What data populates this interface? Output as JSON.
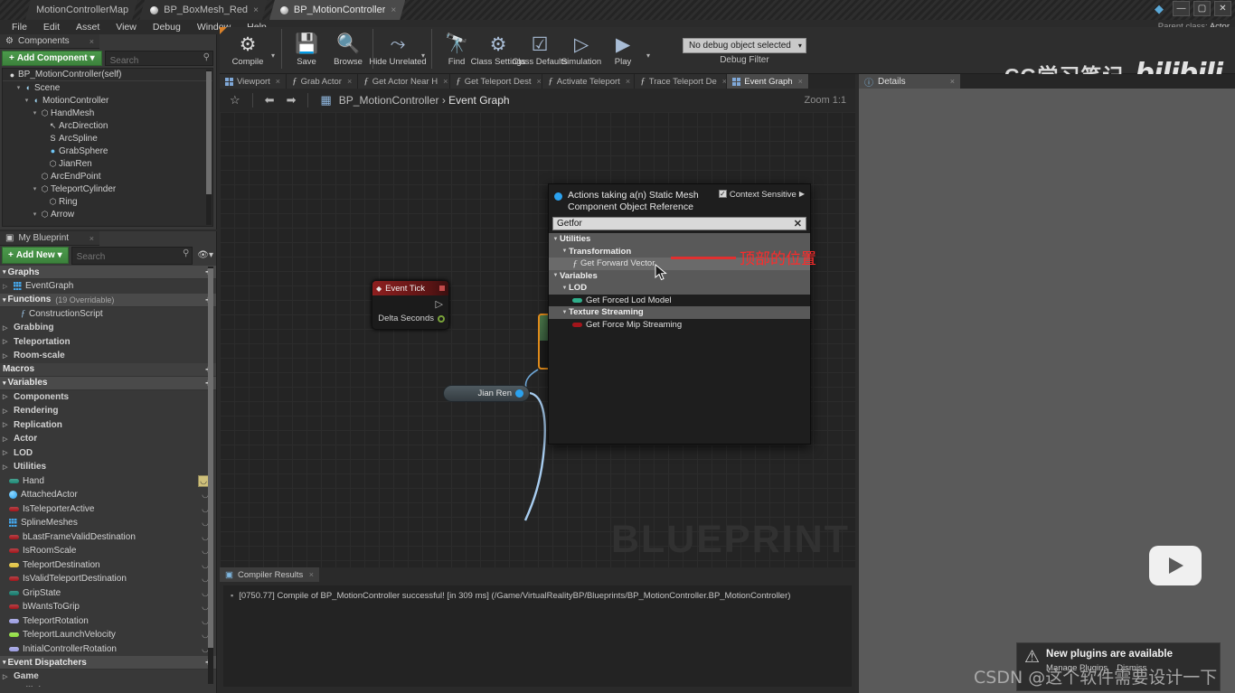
{
  "window": {
    "logo_icon": "unreal-engine-logo",
    "tabs": [
      {
        "label": "MotionControllerMap",
        "active": false,
        "has_dot": false,
        "closable": false
      },
      {
        "label": "BP_BoxMesh_Red",
        "active": false,
        "has_dot": true,
        "closable": true
      },
      {
        "label": "BP_MotionController",
        "active": true,
        "has_dot": true,
        "closable": true
      }
    ],
    "controls": {
      "gem_icon": "unreal-gem-icon",
      "minimize": "—",
      "maximize": "▢",
      "close": "✕"
    }
  },
  "menubar": {
    "items": [
      "File",
      "Edit",
      "Asset",
      "View",
      "Debug",
      "Window",
      "Help"
    ],
    "parent_class_label": "Parent class:",
    "parent_class_value": "Actor"
  },
  "components_panel": {
    "tab_label": "Components",
    "tab_close": "×",
    "add_component_label": "Add Component",
    "add_component_caret": "▾",
    "search_placeholder": "Search",
    "search_icon": "magnifier-icon",
    "root": {
      "label": "BP_MotionController(self)",
      "icon": "sphere-icon"
    },
    "tree": [
      {
        "label": "Scene",
        "depth": 1,
        "arrow": "▾",
        "icon": "scene-icon"
      },
      {
        "label": "MotionController",
        "depth": 2,
        "arrow": "▾",
        "icon": "scene-icon"
      },
      {
        "label": "HandMesh",
        "depth": 3,
        "arrow": "▾",
        "icon": "mesh-icon"
      },
      {
        "label": "ArcDirection",
        "depth": 4,
        "arrow": "",
        "icon": "arrow-icon"
      },
      {
        "label": "ArcSpline",
        "depth": 4,
        "arrow": "",
        "icon": "spline-icon"
      },
      {
        "label": "GrabSphere",
        "depth": 4,
        "arrow": "",
        "icon": "sphere-icon"
      },
      {
        "label": "JianRen",
        "depth": 4,
        "arrow": "",
        "icon": "mesh-icon"
      },
      {
        "label": "ArcEndPoint",
        "depth": 3,
        "arrow": "",
        "icon": "mesh-icon"
      },
      {
        "label": "TeleportCylinder",
        "depth": 3,
        "arrow": "▾",
        "icon": "mesh-icon"
      },
      {
        "label": "Ring",
        "depth": 4,
        "arrow": "",
        "icon": "mesh-icon"
      },
      {
        "label": "Arrow",
        "depth": 3,
        "arrow": "▾",
        "icon": "mesh-icon"
      }
    ]
  },
  "myblueprint_panel": {
    "tab_label": "My Blueprint",
    "tab_close": "×",
    "add_new_label": "Add New",
    "add_new_caret": "▾",
    "search_placeholder": "Search",
    "eye_icon": "eye-icon",
    "sections": [
      {
        "type": "section",
        "label": "Graphs",
        "arrow": "▾",
        "plus": "+"
      },
      {
        "type": "item",
        "label": "EventGraph",
        "arrow": "▷",
        "icon": "graph-icon",
        "bold": false,
        "indent": 0
      },
      {
        "type": "section",
        "label": "Functions",
        "count": "(19 Overridable)",
        "arrow": "▾",
        "plus": "+"
      },
      {
        "type": "item",
        "label": "ConstructionScript",
        "arrow": "",
        "icon": "function-icon",
        "bold": false,
        "indent": 1
      },
      {
        "type": "item",
        "label": "Grabbing",
        "arrow": "▷",
        "icon": "",
        "bold": true,
        "indent": 0
      },
      {
        "type": "item",
        "label": "Teleportation",
        "arrow": "▷",
        "icon": "",
        "bold": true,
        "indent": 0
      },
      {
        "type": "item",
        "label": "Room-scale",
        "arrow": "▷",
        "icon": "",
        "bold": true,
        "indent": 0
      },
      {
        "type": "section-plain",
        "label": "Macros",
        "arrow": "",
        "plus": "+"
      },
      {
        "type": "section",
        "label": "Variables",
        "arrow": "▾",
        "plus": "+"
      },
      {
        "type": "item",
        "label": "Components",
        "arrow": "▷",
        "icon": "",
        "bold": true,
        "indent": 0
      },
      {
        "type": "item",
        "label": "Rendering",
        "arrow": "▷",
        "icon": "",
        "bold": true,
        "indent": 0
      },
      {
        "type": "item",
        "label": "Replication",
        "arrow": "▷",
        "icon": "",
        "bold": true,
        "indent": 0
      },
      {
        "type": "item",
        "label": "Actor",
        "arrow": "▷",
        "icon": "",
        "bold": true,
        "indent": 0
      },
      {
        "type": "item",
        "label": "LOD",
        "arrow": "▷",
        "icon": "",
        "bold": true,
        "indent": 0
      },
      {
        "type": "item",
        "label": "Utilities",
        "arrow": "▷",
        "icon": "",
        "bold": true,
        "indent": 0
      },
      {
        "type": "var",
        "label": "Hand",
        "icon": "pill",
        "color": "#1d8a76",
        "eye": "boxed"
      },
      {
        "type": "var",
        "label": "AttachedActor",
        "icon": "sphere",
        "color": "#2ba2ef",
        "eye": "eye"
      },
      {
        "type": "var",
        "label": "IsTeleporterActive",
        "icon": "pill",
        "color": "#a3151b",
        "eye": "eye"
      },
      {
        "type": "var",
        "label": "SplineMeshes",
        "icon": "grid",
        "color": "#45a5e8",
        "eye": "eye"
      },
      {
        "type": "var",
        "label": "bLastFrameValidDestination",
        "icon": "pill",
        "color": "#a3151b",
        "eye": "eye"
      },
      {
        "type": "var",
        "label": "IsRoomScale",
        "icon": "pill",
        "color": "#a3151b",
        "eye": "eye"
      },
      {
        "type": "var",
        "label": "TeleportDestination",
        "icon": "pill",
        "color": "#e0c03a",
        "eye": "eye"
      },
      {
        "type": "var",
        "label": "IsValidTeleportDestination",
        "icon": "pill",
        "color": "#a3151b",
        "eye": "eye"
      },
      {
        "type": "var",
        "label": "GripState",
        "icon": "pill",
        "color": "#127a6b",
        "eye": "eye"
      },
      {
        "type": "var",
        "label": "bWantsToGrip",
        "icon": "pill",
        "color": "#a3151b",
        "eye": "eye"
      },
      {
        "type": "var",
        "label": "TeleportRotation",
        "icon": "pill",
        "color": "#9b9ce0",
        "eye": "eye"
      },
      {
        "type": "var",
        "label": "TeleportLaunchVelocity",
        "icon": "pill",
        "color": "#8ddc3a",
        "eye": "eye"
      },
      {
        "type": "var",
        "label": "InitialControllerRotation",
        "icon": "pill",
        "color": "#9b9ce0",
        "eye": "eye"
      },
      {
        "type": "section",
        "label": "Event Dispatchers",
        "arrow": "▾",
        "plus": "+"
      },
      {
        "type": "item",
        "label": "Game",
        "arrow": "▷",
        "icon": "",
        "bold": true,
        "indent": 0
      },
      {
        "type": "item",
        "label": "Collision",
        "arrow": "▷",
        "icon": "",
        "bold": true,
        "indent": 0
      }
    ]
  },
  "toolbar": {
    "buttons": [
      {
        "label": "Compile",
        "icon": "compile-gear-question-icon",
        "glyph": "⚙",
        "caret": true
      },
      {
        "label": "Save",
        "icon": "save-floppy-icon",
        "glyph": "💾",
        "caret": false
      },
      {
        "label": "Browse",
        "icon": "browse-magnifier-icon",
        "glyph": "🔍",
        "caret": false
      },
      {
        "label": "Hide Unrelated",
        "icon": "hide-unrelated-nodes-icon",
        "glyph": "⤳",
        "caret": true
      },
      {
        "label": "Find",
        "icon": "find-binoculars-icon",
        "glyph": "🔭",
        "caret": false
      },
      {
        "label": "Class Settings",
        "icon": "class-settings-gear-icon",
        "glyph": "⚙",
        "caret": false
      },
      {
        "label": "Class Defaults",
        "icon": "class-defaults-list-icon",
        "glyph": "☑",
        "caret": false
      },
      {
        "label": "Simulation",
        "icon": "simulation-icon",
        "glyph": "▷",
        "caret": false
      },
      {
        "label": "Play",
        "icon": "play-icon",
        "glyph": "▶",
        "caret": true
      }
    ],
    "debug_filter_value": "No debug object selected",
    "debug_filter_caret": "▾",
    "debug_filter_label": "Debug Filter",
    "brand_cg": "CG学习笔记",
    "brand_bilibili": "bilibili"
  },
  "graph_tabs": [
    {
      "label": "Viewport",
      "icon": "viewport-grid-icon",
      "active": false
    },
    {
      "label": "Grab Actor",
      "icon": "function-icon",
      "active": false
    },
    {
      "label": "Get Actor Near H",
      "icon": "function-icon",
      "active": false
    },
    {
      "label": "Get Teleport Dest",
      "icon": "function-icon",
      "active": false
    },
    {
      "label": "Activate Teleport",
      "icon": "function-icon",
      "active": false
    },
    {
      "label": "Trace Teleport De",
      "icon": "function-icon",
      "active": false
    },
    {
      "label": "Event Graph",
      "icon": "graph-icon",
      "active": true
    }
  ],
  "details_panel": {
    "tab_label": "Details",
    "tab_icon": "info-magnifier-icon",
    "tab_close": "×"
  },
  "graph_bar": {
    "favorite_icon": "star-icon",
    "back_icon": "back-arrow-icon",
    "forward_icon": "forward-arrow-icon",
    "graph_icon": "graph-icon",
    "breadcrumb_root": "BP_MotionController",
    "breadcrumb_sep": "›",
    "breadcrumb_leaf": "Event Graph",
    "zoom_label": "Zoom 1:1"
  },
  "graph": {
    "watermark": "BLUEPRINT",
    "nodes": [
      {
        "name": "Event Tick",
        "title": "Event Tick",
        "exec_out_icon": "exec-pin-icon",
        "pin_label": "Delta Seconds"
      },
      {
        "name": "JianRen",
        "title": "Jian Ren"
      }
    ]
  },
  "action_menu": {
    "title": "Actions taking a(n) Static Mesh Component Object Reference",
    "context_sensitive_label": "Context Sensitive",
    "context_sensitive_checked": true,
    "context_sensitive_arrow": "▶",
    "search_value": "Getfor",
    "clear_icon": "close-x-icon",
    "rows": [
      {
        "label": "Utilities",
        "kind": "cat",
        "arrow": "▼",
        "indent": 0
      },
      {
        "label": "Transformation",
        "kind": "sub",
        "arrow": "▼",
        "indent": 1
      },
      {
        "label": "Get Forward Vector",
        "kind": "fn",
        "arrow": "",
        "indent": 2,
        "highlighted": true
      },
      {
        "label": "Variables",
        "kind": "cat",
        "arrow": "▼",
        "indent": 0
      },
      {
        "label": "LOD",
        "kind": "sub",
        "arrow": "▼",
        "indent": 1
      },
      {
        "label": "Get Forced Lod Model",
        "kind": "var",
        "arrow": "",
        "indent": 2,
        "color": "#2fae8a"
      },
      {
        "label": "Texture Streaming",
        "kind": "sub",
        "arrow": "▼",
        "indent": 1
      },
      {
        "label": "Get Force Mip Streaming",
        "kind": "var",
        "arrow": "",
        "indent": 2,
        "color": "#a3151b"
      }
    ]
  },
  "annotation": {
    "text": "顶部的位置",
    "color": "#ff2a2a",
    "underline_color": "#e03030"
  },
  "compiler": {
    "tab_label": "Compiler Results",
    "tab_icon": "compiler-icon",
    "tab_close": "×",
    "bullet": "▪",
    "message": "[0750.77] Compile of BP_MotionController successful! [in 309 ms] (/Game/VirtualRealityBP/Blueprints/BP_MotionController.BP_MotionController)"
  },
  "toast": {
    "warn_icon": "warning-triangle-icon",
    "title": "New plugins are available",
    "actions": [
      "Manage Plugins",
      "Dismiss"
    ]
  },
  "watermarks": {
    "csdn": "CSDN @这个软件需要设计一下",
    "play_overlay_icon": "play-button-icon"
  }
}
